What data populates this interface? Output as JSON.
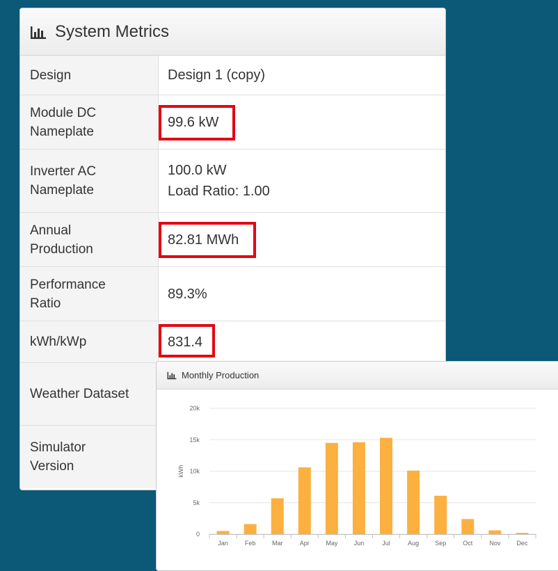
{
  "metrics_panel": {
    "title": "System Metrics",
    "icon": "bar-chart-icon",
    "rows": [
      {
        "label": "Design",
        "value": "Design 1 (copy)",
        "highlighted": false
      },
      {
        "label": "Module DC\nNameplate",
        "value": "99.6 kW",
        "highlighted": true
      },
      {
        "label": "Inverter AC\nNameplate",
        "value": "100.0 kW",
        "value_line2": "Load Ratio: 1.00",
        "highlighted": false
      },
      {
        "label": "Annual\nProduction",
        "value": "82.81 MWh",
        "highlighted": true
      },
      {
        "label": "Performance\nRatio",
        "value": "89.3%",
        "highlighted": false
      },
      {
        "label": "kWh/kWp",
        "value": "831.4",
        "highlighted": true
      },
      {
        "label": "Weather Dataset",
        "value": "",
        "highlighted": false
      },
      {
        "label": "Simulator\nVersion",
        "value": "",
        "highlighted": false
      }
    ],
    "highlight_color": "#e30613"
  },
  "production_panel": {
    "title": "Monthly Production",
    "icon": "bar-chart-icon"
  },
  "chart_data": {
    "type": "bar",
    "categories": [
      "Jan",
      "Feb",
      "Mar",
      "Apr",
      "May",
      "Jun",
      "Jul",
      "Aug",
      "Sep",
      "Oct",
      "Nov",
      "Dec"
    ],
    "values": [
      500,
      1600,
      5700,
      10600,
      14500,
      14600,
      15300,
      10100,
      6100,
      2400,
      600,
      200
    ],
    "ylabel": "kWh",
    "ylim": [
      0,
      20000
    ],
    "yticks": [
      0,
      5000,
      10000,
      15000,
      20000
    ],
    "ytick_labels": [
      "0",
      "5k",
      "10k",
      "15k",
      "20k"
    ],
    "grid": true,
    "bar_color": "#fbb040"
  },
  "colors": {
    "background": "#0b5877",
    "panel_header": "#eeeeee",
    "label_cell": "#f4f4f4"
  }
}
